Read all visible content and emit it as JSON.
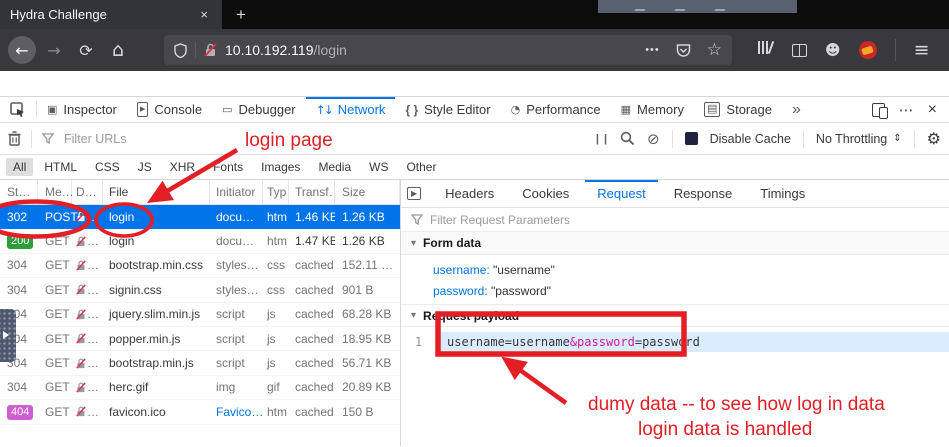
{
  "browser": {
    "tab_title": "Hydra Challenge",
    "close_tab": "×",
    "new_tab": "+",
    "url_host": "10.10.192.119",
    "url_path": "/login"
  },
  "icons": {
    "back": "←",
    "forward": "→",
    "reload": "⟳",
    "home": "⌂",
    "dots": "•••",
    "star": "☆",
    "pocket": "⌄",
    "account": "☻",
    "menu": "≡",
    "pick": "⇱",
    "inspector": "▣",
    "console": "▸",
    "debugger": "▭",
    "network": "↑↓",
    "style_editor": "{ }",
    "performance": "◔",
    "memory": "▦",
    "storage": "▤",
    "overflow": "»",
    "ellipsis": "⋯",
    "close": "×",
    "pause": "| |",
    "search": "⌕",
    "block": "⊘",
    "gear": "⚙",
    "select_arrows": "⇕",
    "funnel": "▽",
    "triangle_down": "▾",
    "panel_toggle": "▶"
  },
  "devtools": {
    "tabs": [
      {
        "label": "Inspector"
      },
      {
        "label": "Console"
      },
      {
        "label": "Debugger"
      },
      {
        "label": "Network"
      },
      {
        "label": "Style Editor"
      },
      {
        "label": "Performance"
      },
      {
        "label": "Memory"
      },
      {
        "label": "Storage"
      }
    ],
    "active_tab": "Network"
  },
  "net_toolbar": {
    "filter_placeholder": "Filter URLs",
    "disable_cache_label": "Disable Cache",
    "throttling_label": "No Throttling"
  },
  "filters": {
    "items": [
      {
        "label": "All"
      },
      {
        "label": "HTML"
      },
      {
        "label": "CSS"
      },
      {
        "label": "JS"
      },
      {
        "label": "XHR"
      },
      {
        "label": "Fonts"
      },
      {
        "label": "Images"
      },
      {
        "label": "Media"
      },
      {
        "label": "WS"
      },
      {
        "label": "Other"
      }
    ],
    "active": "All"
  },
  "network": {
    "columns": {
      "status": "St…",
      "method": "Me…",
      "domain": "D…",
      "file": "File",
      "initiator": "Initiator",
      "type": "Typ",
      "transferred": "Transf…",
      "size": "Size"
    },
    "domain_ellipsis": "…",
    "rows": [
      {
        "status": "302",
        "method": "POST",
        "file": "login",
        "initiator": "docu…",
        "type": "htm",
        "transferred": "1.46 KB",
        "size": "1.26 KB"
      },
      {
        "status": "200",
        "method": "GET",
        "file": "login",
        "initiator": "docu…",
        "type": "htm",
        "transferred": "1.47 KB",
        "size": "1.26 KB"
      },
      {
        "status": "304",
        "method": "GET",
        "file": "bootstrap.min.css",
        "initiator": "styles…",
        "type": "css",
        "transferred": "cached",
        "size": "152.11 …"
      },
      {
        "status": "304",
        "method": "GET",
        "file": "signin.css",
        "initiator": "styles…",
        "type": "css",
        "transferred": "cached",
        "size": "901 B"
      },
      {
        "status": "304",
        "method": "GET",
        "file": "jquery.slim.min.js",
        "initiator": "script",
        "type": "js",
        "transferred": "cached",
        "size": "68.28 KB"
      },
      {
        "status": "304",
        "method": "GET",
        "file": "popper.min.js",
        "initiator": "script",
        "type": "js",
        "transferred": "cached",
        "size": "18.95 KB"
      },
      {
        "status": "304",
        "method": "GET",
        "file": "bootstrap.min.js",
        "initiator": "script",
        "type": "js",
        "transferred": "cached",
        "size": "56.71 KB"
      },
      {
        "status": "304",
        "method": "GET",
        "file": "herc.gif",
        "initiator": "img",
        "type": "gif",
        "transferred": "cached",
        "size": "20.89 KB"
      },
      {
        "status": "404",
        "method": "GET",
        "file": "favicon.ico",
        "initiator": "Favico…",
        "type": "htm",
        "transferred": "cached",
        "size": "150 B"
      }
    ]
  },
  "details": {
    "tabs": [
      {
        "label": "Headers"
      },
      {
        "label": "Cookies"
      },
      {
        "label": "Request"
      },
      {
        "label": "Response"
      },
      {
        "label": "Timings"
      }
    ],
    "active_tab": "Request",
    "filter_placeholder": "Filter Request Parameters",
    "form_data": {
      "title": "Form data",
      "items": [
        {
          "name": "username:",
          "value": "\"username\""
        },
        {
          "name": "password:",
          "value": "\"password\""
        }
      ]
    },
    "request_payload": {
      "title": "Request payload",
      "line_number": "1",
      "code_pre": "username=username",
      "code_mark": "&password",
      "code_post": "=password"
    }
  },
  "annotations": {
    "login_page": "login page",
    "dummy_line1": "dumy data -- to see how log in data",
    "dummy_line2": "login data is handled",
    "color": "#e41e25"
  }
}
